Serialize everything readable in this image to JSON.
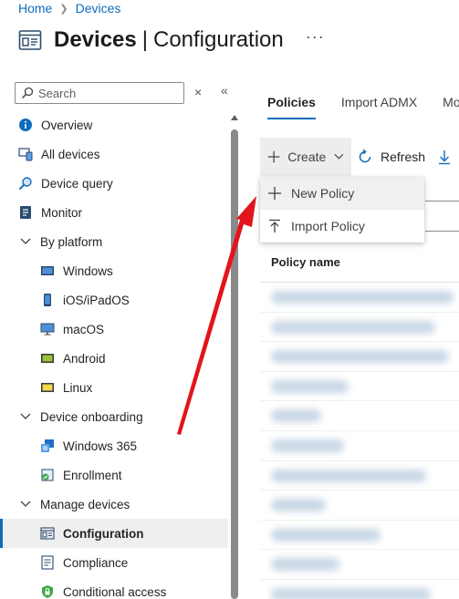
{
  "breadcrumb": {
    "home": "Home",
    "devices": "Devices"
  },
  "header": {
    "title": "Devices",
    "separator": "|",
    "subtitle": "Configuration",
    "more": "···"
  },
  "sidebar": {
    "search_placeholder": "Search",
    "clear": "×",
    "collapse": "«",
    "items": [
      {
        "label": "Overview",
        "icon": "info-icon"
      },
      {
        "label": "All devices",
        "icon": "devices-icon"
      },
      {
        "label": "Device query",
        "icon": "query-icon"
      },
      {
        "label": "Monitor",
        "icon": "monitor-icon"
      },
      {
        "label": "By platform",
        "icon": "chevron-down-icon"
      },
      {
        "label": "Windows",
        "icon": "windows-icon"
      },
      {
        "label": "iOS/iPadOS",
        "icon": "phone-icon"
      },
      {
        "label": "macOS",
        "icon": "desktop-icon"
      },
      {
        "label": "Android",
        "icon": "android-icon"
      },
      {
        "label": "Linux",
        "icon": "linux-icon"
      },
      {
        "label": "Device onboarding",
        "icon": "chevron-down-icon"
      },
      {
        "label": "Windows 365",
        "icon": "windows365-icon"
      },
      {
        "label": "Enrollment",
        "icon": "enrollment-icon"
      },
      {
        "label": "Manage devices",
        "icon": "chevron-down-icon"
      },
      {
        "label": "Configuration",
        "icon": "configuration-icon"
      },
      {
        "label": "Compliance",
        "icon": "compliance-icon"
      },
      {
        "label": "Conditional access",
        "icon": "lock-icon"
      }
    ]
  },
  "tabs": [
    {
      "label": "Policies"
    },
    {
      "label": "Import ADMX"
    },
    {
      "label": "Mo"
    }
  ],
  "toolbar": {
    "create": "Create",
    "refresh": "Refresh"
  },
  "create_menu": {
    "new_policy": "New Policy",
    "import_policy": "Import Policy"
  },
  "table": {
    "column_policy_name": "Policy name"
  },
  "colors": {
    "accent": "#0f6cbd",
    "arrow": "#e3141b",
    "selected_bg": "#efefef"
  }
}
